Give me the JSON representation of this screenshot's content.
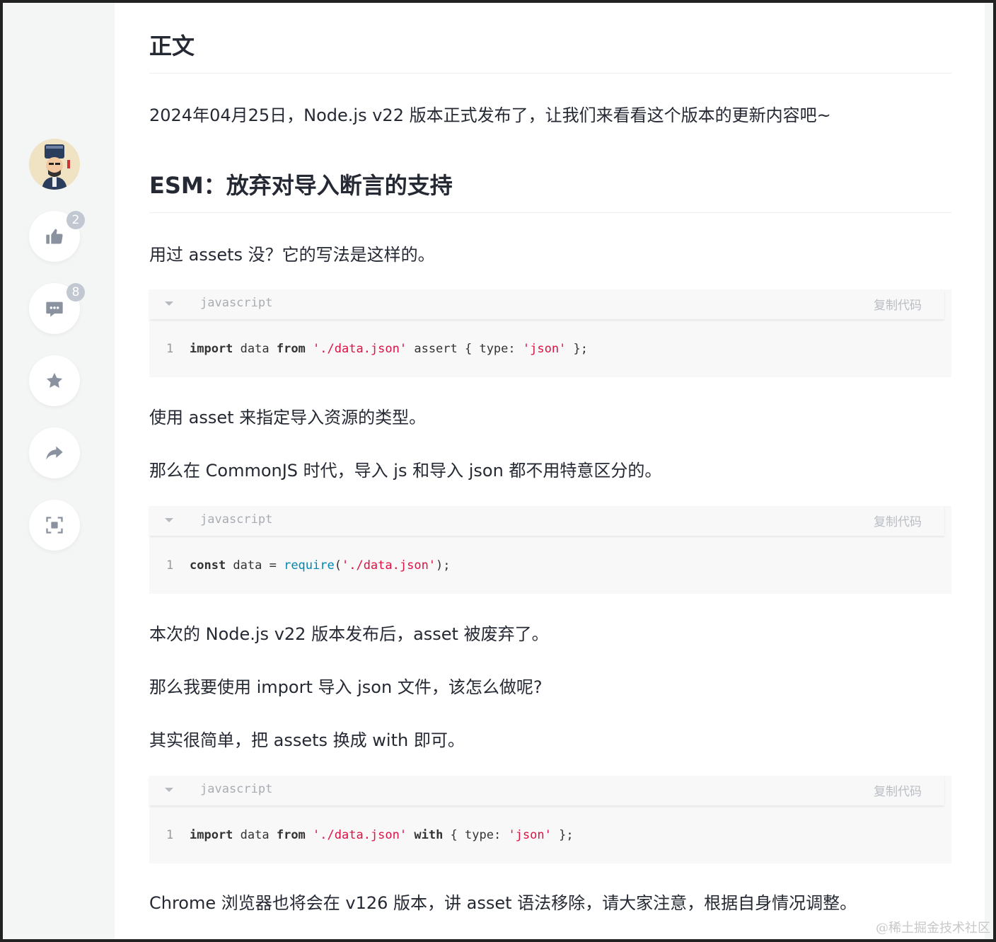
{
  "sidebar": {
    "like_count": "2",
    "comment_count": "8"
  },
  "article": {
    "heading_main": "正文",
    "intro": "2024年04月25日，Node.js v22 版本正式发布了，让我们来看看这个版本的更新内容吧~",
    "heading_esm": "ESM：放弃对导入断言的支持",
    "p1": "用过 assets 没？它的写法是这样的。",
    "p2": "使用 asset 来指定导入资源的类型。",
    "p3": "那么在 CommonJS 时代，导入 js 和导入 json 都不用特意区分的。",
    "p4": "本次的 Node.js v22 版本发布后，asset 被废弃了。",
    "p5": "那么我要使用 import 导入 json 文件，该怎么做呢?",
    "p6": "其实很简单，把 assets 换成 with 即可。",
    "p7": "Chrome 浏览器也将会在 v126 版本，讲 asset 语法移除，请大家注意，根据自身情况调整。"
  },
  "code_blocks": [
    {
      "lang": "javascript",
      "copy_label": "复制代码",
      "line_no": "1",
      "t_import": "import",
      "t_data": " data ",
      "t_from": "from",
      "t_sp": " ",
      "t_path": "'./data.json'",
      "t_assert": " assert { type: ",
      "t_json": "'json'",
      "t_end": " };"
    },
    {
      "lang": "javascript",
      "copy_label": "复制代码",
      "line_no": "1",
      "t_const": "const",
      "t_data": " data = ",
      "t_require": "require",
      "t_paren": "(",
      "t_path": "'./data.json'",
      "t_end": ");"
    },
    {
      "lang": "javascript",
      "copy_label": "复制代码",
      "line_no": "1",
      "t_import": "import",
      "t_data": " data ",
      "t_from": "from",
      "t_sp": " ",
      "t_path": "'./data.json'",
      "t_sp2": " ",
      "t_with": "with",
      "t_type": " { type: ",
      "t_json": "'json'",
      "t_end": " };"
    }
  ],
  "watermark": "@稀土掘金技术社区",
  "colors": {
    "text": "#252933",
    "icon": "#8a919f",
    "string": "#dd1144",
    "builtin": "#0086b3"
  }
}
